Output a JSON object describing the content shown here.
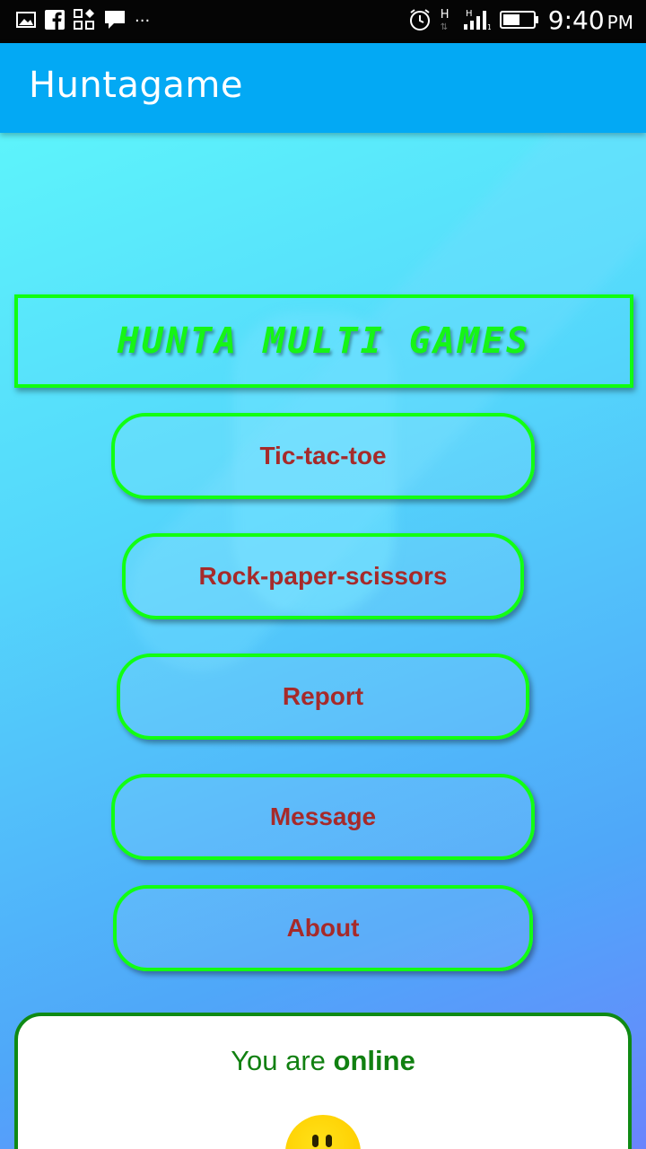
{
  "status_bar": {
    "time": "9:40",
    "ampm": "PM",
    "icons_left": [
      "image-icon",
      "facebook-icon",
      "app-grid-icon",
      "chat-icon",
      "more-dots-icon"
    ],
    "icons_right": [
      "alarm-icon",
      "h-network-icon",
      "signal-icon",
      "battery-icon"
    ],
    "more_label": "···",
    "network_label": "H"
  },
  "app_bar": {
    "title": "Huntagame"
  },
  "banner": {
    "title": "HUNTA MULTI GAMES",
    "color": "#16f516"
  },
  "menu": {
    "tic_tac_toe": "Tic-tac-toe",
    "rock_paper_scissors": "Rock-paper-scissors",
    "report": "Report",
    "message": "Message",
    "about": "About"
  },
  "status_card": {
    "prefix": "You are ",
    "state": "online",
    "color": "#118011"
  },
  "colors": {
    "app_bar": "#03a9f4",
    "button_border": "#12ff12",
    "button_text": "#a62a2a"
  }
}
